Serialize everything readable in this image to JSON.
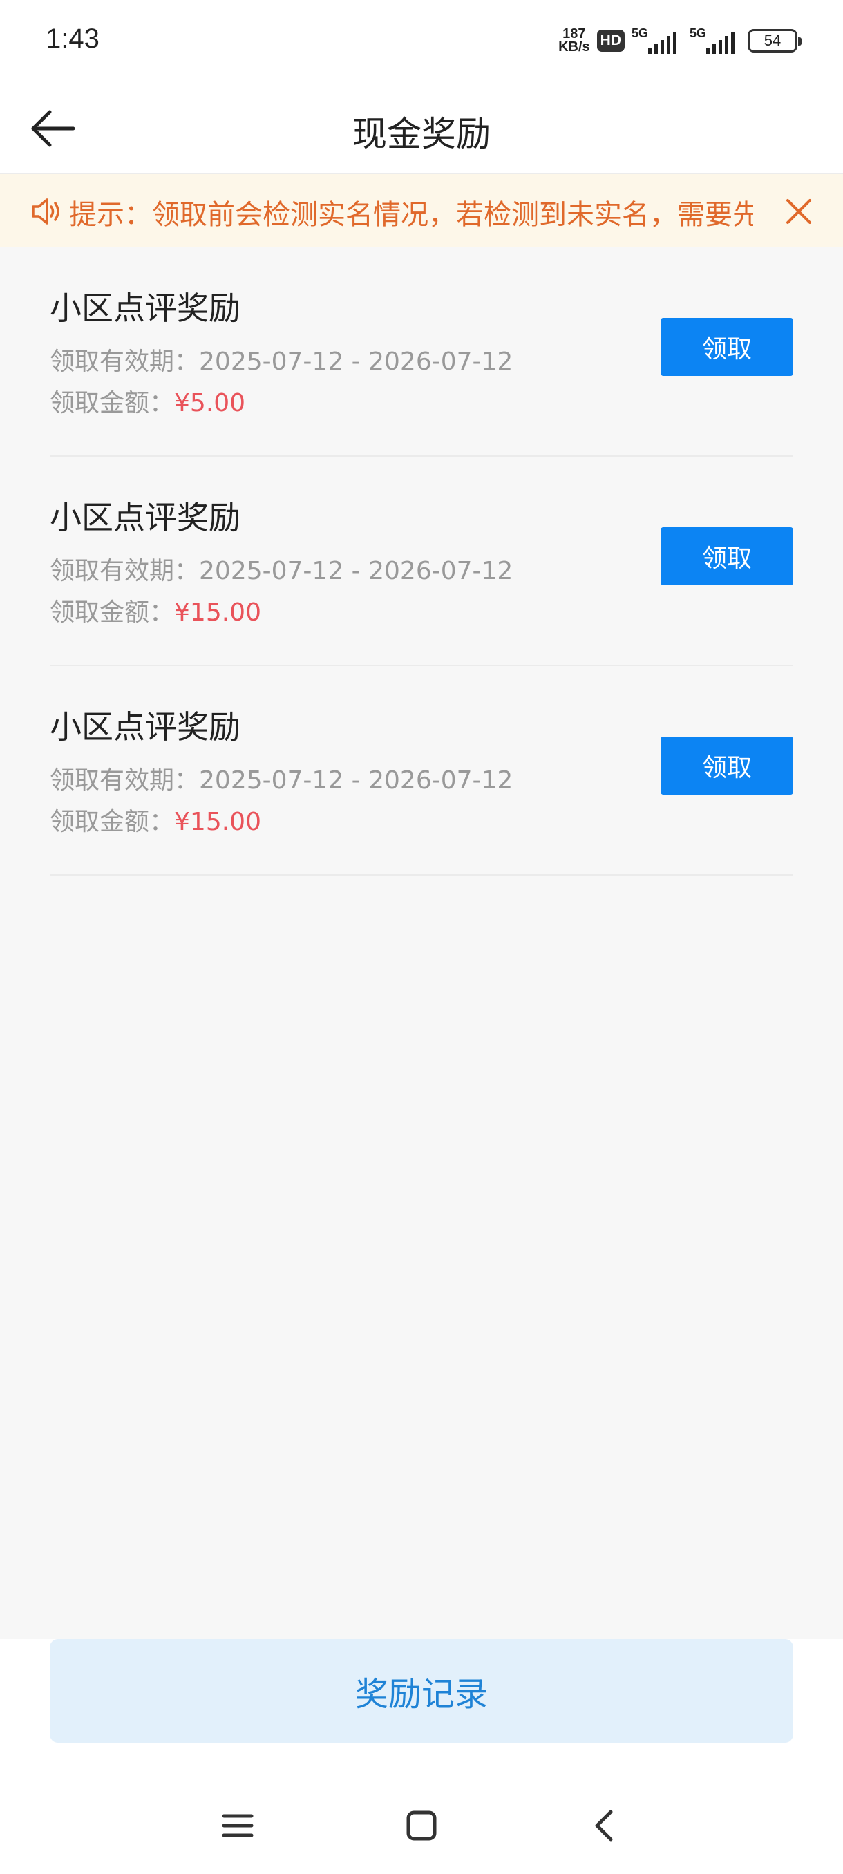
{
  "status_bar": {
    "time": "1:43",
    "speed_value": "187",
    "speed_unit": "KB/s",
    "hd_label": "HD",
    "signal1_label": "5G",
    "signal2_label": "5G",
    "battery": "54"
  },
  "header": {
    "title": "现金奖励",
    "back_icon": "arrow-left-icon"
  },
  "notice": {
    "icon": "speaker-icon",
    "text": "提示：领取前会检测实名情况，若检测到未实名，需要先完成实名认证并完善信息",
    "close_icon": "close-icon"
  },
  "rewards": [
    {
      "title": "小区点评奖励",
      "period_label": "领取有效期：",
      "period": "2025-07-12 - 2026-07-12",
      "amount_label": "领取金额：",
      "amount": "¥5.00",
      "button": "领取"
    },
    {
      "title": "小区点评奖励",
      "period_label": "领取有效期：",
      "period": "2025-07-12 - 2026-07-12",
      "amount_label": "领取金额：",
      "amount": "¥15.00",
      "button": "领取"
    },
    {
      "title": "小区点评奖励",
      "period_label": "领取有效期：",
      "period": "2025-07-12 - 2026-07-12",
      "amount_label": "领取金额：",
      "amount": "¥15.00",
      "button": "领取"
    }
  ],
  "records_button": "奖励记录",
  "nav_bar": {
    "menu_icon": "menu-icon",
    "home_icon": "home-square-icon",
    "back_icon": "chevron-left-icon"
  },
  "colors": {
    "accent": "#0c84f3",
    "amount": "#e9535a",
    "notice_text": "#e0692b",
    "notice_bg": "#fdf7e9",
    "records_bg": "#e2f0fb"
  }
}
